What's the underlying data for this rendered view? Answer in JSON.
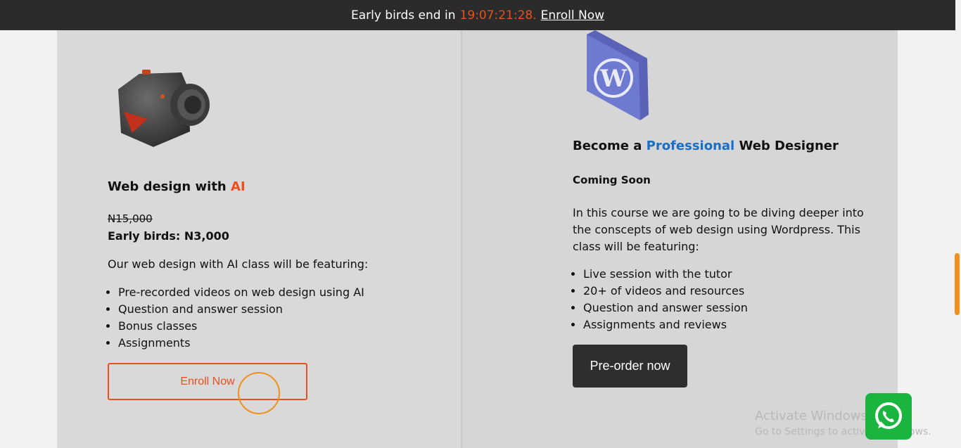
{
  "topbar": {
    "prefix": "Early birds end in",
    "timer": "19:07:21:28.",
    "link": "Enroll Now"
  },
  "left_card": {
    "title_main": "Web design with",
    "title_accent": "AI",
    "old_price": "N15,000",
    "early_price": "Early birds: N3,000",
    "intro": "Our web design with AI class will be featuring:",
    "features": [
      "Pre-recorded videos on web design using AI",
      "Question and answer session",
      "Bonus classes",
      "Assignments"
    ],
    "button": "Enroll Now"
  },
  "right_card": {
    "title_pre": "Become a",
    "title_accent": "Professional",
    "title_post": "Web Designer",
    "status": "Coming Soon",
    "intro": "In this course we are going to be diving deeper into the conscepts of web design using Wordpress. This class will be featuring:",
    "features": [
      "Live session with the tutor",
      "20+ of videos and resources",
      "Question and answer session",
      "Assignments and reviews"
    ],
    "button": "Pre-order now"
  },
  "watermark": {
    "line1": "Activate Windows",
    "line2": "Go to Settings to activate Windows."
  },
  "colors": {
    "accent_orange": "#e8501c",
    "accent_blue": "#1a6fc4",
    "whatsapp_green": "#19b53f"
  },
  "icons": [
    "camera-icon",
    "wordpress-icon",
    "whatsapp-icon"
  ]
}
